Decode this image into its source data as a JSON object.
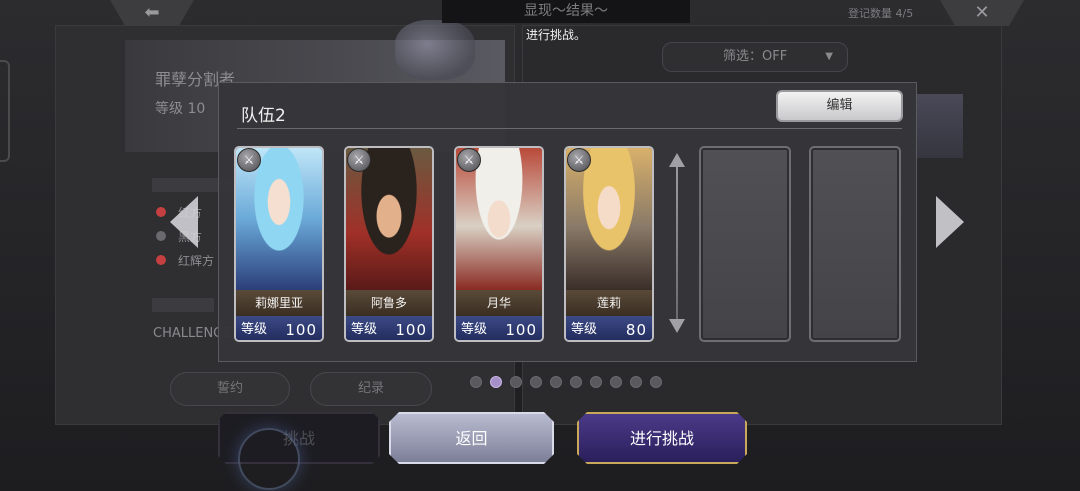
{
  "top_bar": {
    "title": "显现～结果～",
    "subtitle": "进行挑战。",
    "count": "登记数量 4/5",
    "back_icon": "arrow-left-icon",
    "close_icon": "close-x-icon"
  },
  "background": {
    "banner_title": "罪孽分割者",
    "rank_label": "等级",
    "rank_value": "10",
    "rows": [
      "红方",
      "黑方",
      "红辉方"
    ],
    "challenge_text": "CHALLENGE",
    "btn_contract": "誓约",
    "btn_record": "纪录",
    "filter_label": "筛选：OFF"
  },
  "team": {
    "title": "队伍2",
    "edit_label": "编辑",
    "level_label": "等级",
    "members": [
      {
        "name": "莉娜里亚",
        "level": "100"
      },
      {
        "name": "阿鲁多",
        "level": "100"
      },
      {
        "name": "月华",
        "level": "100"
      },
      {
        "name": "莲莉",
        "level": "80"
      }
    ],
    "empty_slots": 2
  },
  "pagination": {
    "total": 10,
    "current": 2
  },
  "buttons": {
    "challenge_bg": "挑战",
    "back": "返回",
    "start": "进行挑战"
  },
  "colors": {
    "accent_gold": "#c9a85a",
    "accent_purple": "#4b3a88",
    "level_bar": "#2c3870"
  }
}
